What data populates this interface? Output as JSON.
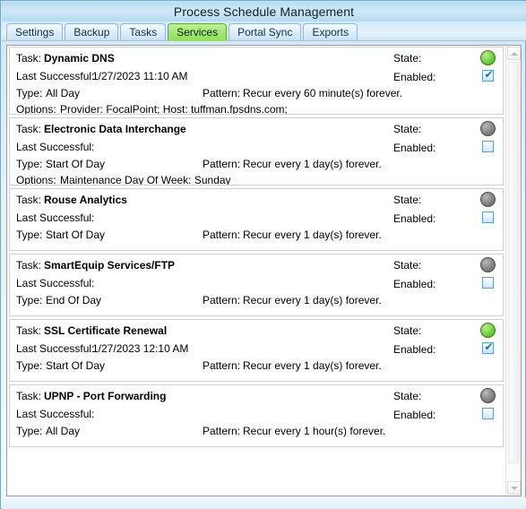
{
  "window": {
    "title": "Process Schedule Management"
  },
  "tabs": [
    {
      "label": "Settings",
      "active": false
    },
    {
      "label": "Backup",
      "active": false
    },
    {
      "label": "Tasks",
      "active": false
    },
    {
      "label": "Services",
      "active": true
    },
    {
      "label": "Portal Sync",
      "active": false
    },
    {
      "label": "Exports",
      "active": false
    }
  ],
  "labels": {
    "task": "Task:",
    "last_successful": "Last Successful:",
    "type": "Type:",
    "pattern": "Pattern:",
    "options": "Options:",
    "state": "State:",
    "enabled": "Enabled:"
  },
  "colors": {
    "accent_title": "#b9dcf2",
    "active_tab": "#8fe05c",
    "led_on": "#7fd44c",
    "led_off": "#8d8d8d",
    "checkbox_border": "#5a9fd4",
    "check_mark": "#1d6fb8"
  },
  "tasks": [
    {
      "name": "Dynamic DNS",
      "last_successful": "1/27/2023 11:10 AM",
      "type": "All Day",
      "pattern": "Recur every 60 minute(s) forever.",
      "options": "Provider: FocalPoint; Host: tuffman.fpsdns.com;",
      "state": "on",
      "enabled": true
    },
    {
      "name": "Electronic Data Interchange",
      "last_successful": "",
      "type": "Start Of Day",
      "pattern": "Recur every 1 day(s) forever.",
      "options": "Maintenance Day Of Week: Sunday",
      "state": "off",
      "enabled": false
    },
    {
      "name": "Rouse Analytics",
      "last_successful": "",
      "type": "Start Of Day",
      "pattern": "Recur every 1 day(s) forever.",
      "options": "",
      "state": "off",
      "enabled": false
    },
    {
      "name": "SmartEquip Services/FTP",
      "last_successful": "",
      "type": "End Of Day",
      "pattern": "Recur every 1 day(s) forever.",
      "options": "",
      "state": "off",
      "enabled": false
    },
    {
      "name": "SSL Certificate Renewal",
      "last_successful": "1/27/2023 12:10 AM",
      "type": "Start Of Day",
      "pattern": "Recur every 1 day(s) forever.",
      "options": "",
      "state": "off",
      "enabled": true
    },
    {
      "name": "UPNP - Port Forwarding",
      "last_successful": "",
      "type": "All Day",
      "pattern": "Recur every 1 hour(s) forever.",
      "options": "",
      "state": "off",
      "enabled": false
    }
  ],
  "task_state_overrides": {
    "4": "on"
  },
  "scrollbar": {
    "up_arrow": "chevron-up-icon",
    "down_arrow": "chevron-down-icon"
  },
  "checkmark_glyph": "✔"
}
